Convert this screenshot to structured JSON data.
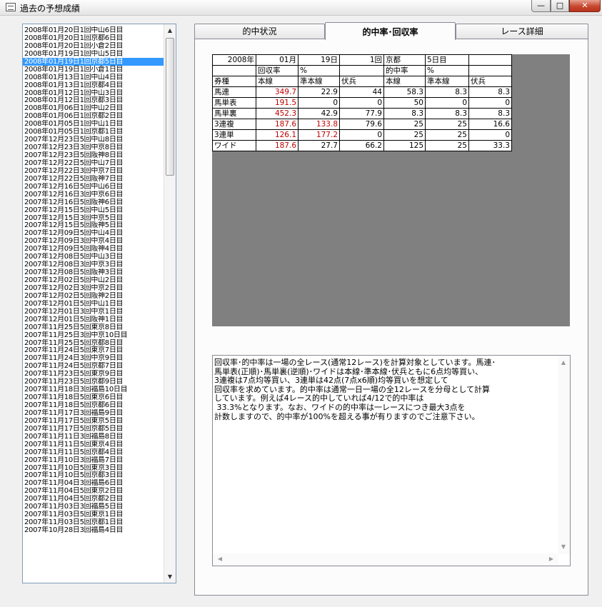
{
  "window": {
    "title": "過去の予想成績",
    "min_label": "—",
    "max_label": "□",
    "close_label": "✕"
  },
  "race_list": [
    "2008年01月20日1回中山6日目",
    "2008年01月20日1回京都6日目",
    "2008年01月20日1回小倉2日目",
    "2008年01月19日1回中山5日目",
    "2008年01月19日1回京都5日目",
    "2008年01月19日1回小倉1日目",
    "2008年01月13日1回中山4日目",
    "2008年01月13日1回京都4日目",
    "2008年01月12日1回中山3日目",
    "2008年01月12日1回京都3日目",
    "2008年01月06日1回中山2日目",
    "2008年01月06日1回京都2日目",
    "2008年01月05日1回中山1日目",
    "2008年01月05日1回京都1日目",
    "2007年12月23日5回中山8日目",
    "2007年12月23日3回中京8日目",
    "2007年12月23日5回阪神8日目",
    "2007年12月22日5回中山7日目",
    "2007年12月22日3回中京7日目",
    "2007年12月22日5回阪神7日目",
    "2007年12月16日5回中山6日目",
    "2007年12月16日3回中京6日目",
    "2007年12月16日5回阪神6日目",
    "2007年12月15日5回中山5日目",
    "2007年12月15日3回中京5日目",
    "2007年12月15日5回阪神5日目",
    "2007年12月09日5回中山4日目",
    "2007年12月09日3回中京4日目",
    "2007年12月09日5回阪神4日目",
    "2007年12月08日5回中山3日目",
    "2007年12月08日3回中京3日目",
    "2007年12月08日5回阪神3日目",
    "2007年12月02日5回中山2日目",
    "2007年12月02日3回中京2日目",
    "2007年12月02日5回阪神2日目",
    "2007年12月01日5回中山1日目",
    "2007年12月01日3回中京1日目",
    "2007年12月01日5回阪神1日目",
    "2007年11月25日5回東京8日目",
    "2007年11月25日3回中京10日目",
    "2007年11月25日5回京都8日目",
    "2007年11月24日5回東京7日目",
    "2007年11月24日3回中京9日目",
    "2007年11月24日5回京都7日目",
    "2007年11月23日5回東京9日目",
    "2007年11月23日5回京都9日目",
    "2007年11月18日3回福島10日目",
    "2007年11月18日5回東京6日目",
    "2007年11月18日5回京都6日目",
    "2007年11月17日3回福島9日目",
    "2007年11月17日5回東京5日目",
    "2007年11月17日5回京都5日目",
    "2007年11月11日3回福島8日目",
    "2007年11月11日5回東京4日目",
    "2007年11月11日5回京都4日目",
    "2007年11月10日3回福島7日目",
    "2007年11月10日5回東京3日目",
    "2007年11月10日5回京都3日目",
    "2007年11月04日3回福島6日目",
    "2007年11月04日5回東京2日目",
    "2007年11月04日5回京都2日目",
    "2007年11月03日3回福島5日目",
    "2007年11月03日5回東京1日目",
    "2007年11月03日5回京都1日目",
    "2007年10月28日3回福島4日目"
  ],
  "selected_index": 4,
  "tabs": [
    "的中状況",
    "的中率･回収率",
    "レース詳細"
  ],
  "grid": {
    "header_rows": [
      [
        "2008年",
        "01月",
        "19日",
        "1回",
        "京都",
        "5日目",
        ""
      ],
      [
        "",
        "回収率",
        "%",
        "",
        "的中率",
        "%",
        ""
      ],
      [
        "券種",
        "本線",
        "準本線",
        "伏兵",
        "本線",
        "準本線",
        "伏兵"
      ]
    ],
    "rows": [
      {
        "type": "馬連",
        "vals": [
          "349.7",
          "22.9",
          "44",
          "58.3",
          "8.3",
          "8.3"
        ],
        "red": [
          0
        ]
      },
      {
        "type": "馬単表",
        "vals": [
          "191.5",
          "0",
          "0",
          "50",
          "0",
          "0"
        ],
        "red": [
          0
        ]
      },
      {
        "type": "馬単裏",
        "vals": [
          "452.3",
          "42.9",
          "77.9",
          "8.3",
          "8.3",
          "8.3"
        ],
        "red": [
          0
        ]
      },
      {
        "type": "3連複",
        "vals": [
          "187.6",
          "133.8",
          "79.6",
          "25",
          "25",
          "16.6"
        ],
        "red": [
          0,
          1
        ]
      },
      {
        "type": "3連単",
        "vals": [
          "126.1",
          "177.2",
          "0",
          "25",
          "25",
          "0"
        ],
        "red": [
          0,
          1
        ]
      },
      {
        "type": "ワイド",
        "vals": [
          "187.6",
          "27.7",
          "66.2",
          "125",
          "25",
          "33.3"
        ],
        "red": [
          0
        ]
      }
    ]
  },
  "note_lines": [
    "回収率･的中率は一場の全レース(通常12レース)を計算対象としています。馬連･",
    "馬単表(正順)･馬単裏(逆順)･ワイドは本線･準本線･伏兵ともに6点均等買い、",
    "3連複は7点均等買い、3連単は42点(7点x6順)均等買いを想定して",
    "回収率を求めています。的中率は通常一日一場の全12レースを分母として計算",
    "しています。例えば4レース的中していれば4/12で的中率は",
    " 33.3%となります。なお、ワイドの的中率は一レースにつき最大3点を",
    "計数しますので、的中率が100%を超える事が有りますのでご注意下さい。"
  ],
  "icons": {
    "scroll_up": "▲",
    "scroll_down": "▼",
    "scroll_left": "◀",
    "scroll_right": "▶"
  }
}
